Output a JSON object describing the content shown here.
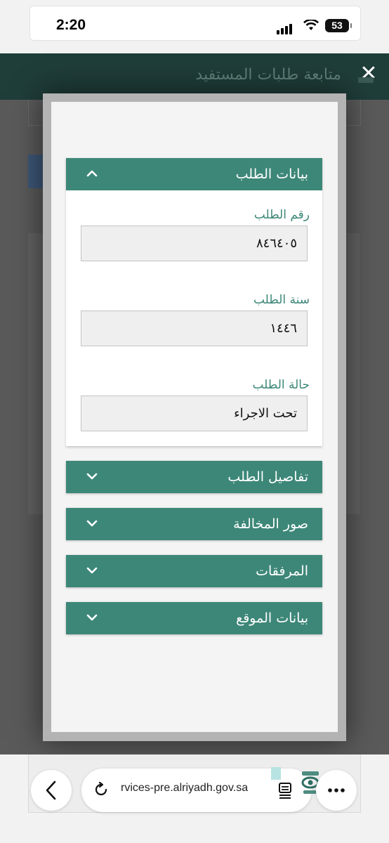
{
  "status_bar": {
    "time": "2:20",
    "battery": "53"
  },
  "page": {
    "title": "متابعة طلبات المستفيد",
    "close_glyph": "✕"
  },
  "modal": {
    "sections": [
      {
        "label": "بيانات الطلب",
        "expanded": true,
        "icon": "chevron-up-icon"
      },
      {
        "label": "تفاصيل الطلب",
        "expanded": false,
        "icon": "chevron-down-icon"
      },
      {
        "label": "صور المخالفة",
        "expanded": false,
        "icon": "chevron-down-icon"
      },
      {
        "label": "المرفقات",
        "expanded": false,
        "icon": "chevron-down-icon"
      },
      {
        "label": "بيانات الموقع",
        "expanded": false,
        "icon": "chevron-down-icon"
      }
    ],
    "fields": [
      {
        "label": "رقم الطلب",
        "value": "٨٤٦٤٠٥"
      },
      {
        "label": "سنة الطلب",
        "value": "١٤٤٦"
      },
      {
        "label": "حالة الطلب",
        "value": "تحت الاجراء"
      }
    ]
  },
  "browser": {
    "url": "rvices-pre.alriyadh.gov.sa"
  },
  "colors": {
    "accent": "#3d8778",
    "header_dark": "#1f3d39"
  }
}
